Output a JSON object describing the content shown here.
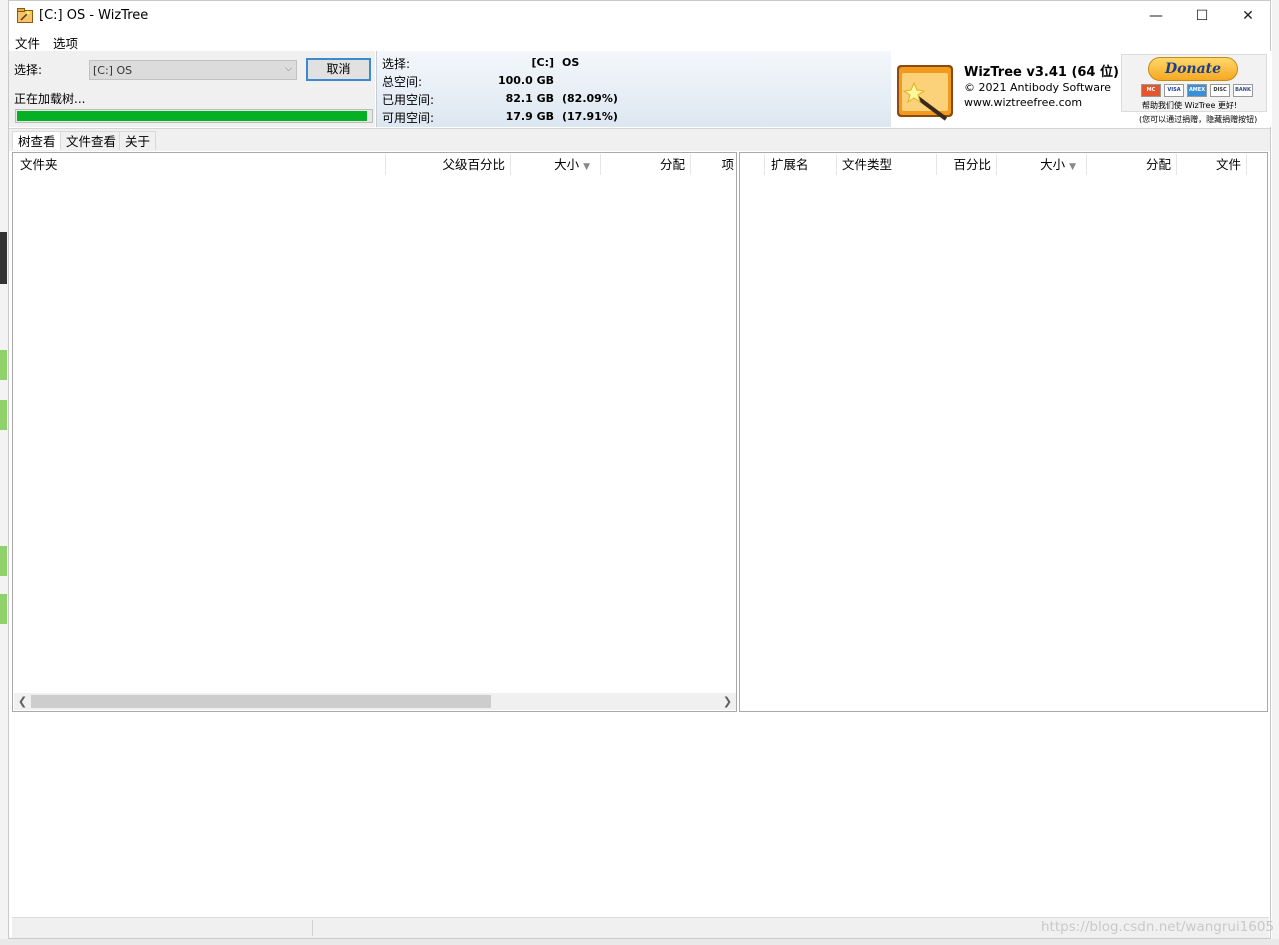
{
  "window": {
    "title": "[C:] OS  - WizTree",
    "controls": {
      "minimize": "—",
      "maximize": "☐",
      "close": "✕"
    }
  },
  "menu": {
    "items": [
      "文件",
      "选项"
    ]
  },
  "selection_panel": {
    "label": "选择:",
    "drive_value": "[C:] OS",
    "cancel_button": "取消",
    "loading_status": "正在加载树...",
    "progress_fraction": 0.99
  },
  "info_panel": {
    "rows": [
      {
        "label": "选择:",
        "value": "[C:]",
        "extra": "OS"
      },
      {
        "label": "总空间:",
        "value": "100.0 GB",
        "extra": ""
      },
      {
        "label": "已用空间:",
        "value": "82.1 GB",
        "extra": "(82.09%)"
      },
      {
        "label": "可用空间:",
        "value": "17.9 GB",
        "extra": "(17.91%)"
      }
    ]
  },
  "about": {
    "product": "WizTree v3.41 (64 位)",
    "copyright": "© 2021 Antibody Software",
    "website": "www.wiztreefree.com"
  },
  "donate": {
    "button_label": "Donate",
    "cards": [
      "MC",
      "VISA",
      "AMEX",
      "DISC",
      "BANK"
    ],
    "help_text": "帮助我们使 WizTree 更好!",
    "hint_text": "(您可以通过捐赠，隐藏捐赠按钮)"
  },
  "tabs": [
    "树查看",
    "文件查看",
    "关于"
  ],
  "tree_columns": [
    "文件夹",
    "父级百分比",
    "大小",
    "分配",
    "项"
  ],
  "ext_columns": [
    "扩展名",
    "文件类型",
    "百分比",
    "大小",
    "分配",
    "文件"
  ],
  "watermark": "https://blog.csdn.net/wangrui1605",
  "colors": {
    "progress": "#06b025",
    "accent": "#3c88d3"
  },
  "icons": {
    "sort": "triangle-down",
    "scroll_left": "chevron-left",
    "scroll_right": "chevron-right"
  }
}
